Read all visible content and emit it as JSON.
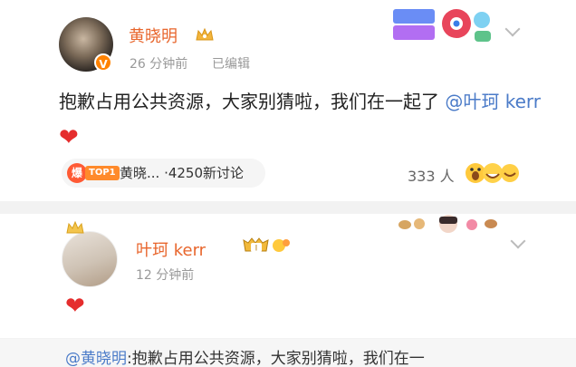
{
  "post1": {
    "username": "黄晓明",
    "time": "26 分钟前",
    "edited": "已编辑",
    "verified_badge": "V",
    "body": "抱歉占用公共资源，大家别猜啦，我们在一起了 ",
    "mention": "@叶珂 kerr",
    "heart": "❤",
    "topic_badge": "爆",
    "topic_rank": "TOP1",
    "topic_text": "黄晓... ·4250新讨论",
    "reaction_count": "333 人"
  },
  "post2": {
    "username": "叶珂 kerr",
    "time": "12 分钟前",
    "heart": "❤",
    "level_badge": "I"
  },
  "quote": {
    "name": "@黄晓明",
    "text": ":抱歉占用公共资源，大家别猜啦，我们在一"
  },
  "colors": {
    "username": "#e8662d",
    "mention": "#4b7bc8",
    "heart": "#e52d2d",
    "meta": "#999999"
  }
}
